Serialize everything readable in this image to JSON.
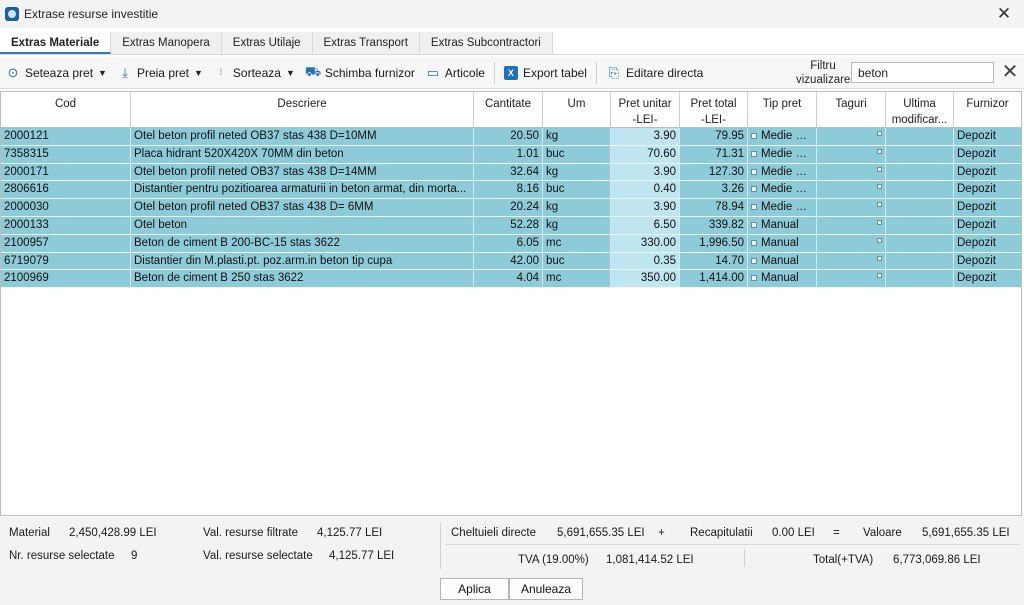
{
  "window": {
    "title": "Extrase resurse investitie"
  },
  "tabs": [
    {
      "label": "Extras Materiale"
    },
    {
      "label": "Extras Manopera"
    },
    {
      "label": "Extras Utilaje"
    },
    {
      "label": "Extras Transport"
    },
    {
      "label": "Extras Subcontractori"
    }
  ],
  "toolbar": {
    "seteaza_pret": "Seteaza pret",
    "preia_pret": "Preia pret",
    "sorteaza": "Sorteaza",
    "schimba_furnizor": "Schimba furnizor",
    "articole": "Articole",
    "export_tabel": "Export tabel",
    "editare_directa": "Editare directa",
    "filter_label_1": "Filtru",
    "filter_label_2": "vizualizare",
    "filter_value": "beton"
  },
  "grid": {
    "headers": {
      "cod": "Cod",
      "descriere": "Descriere",
      "cantitate": "Cantitate",
      "um": "Um",
      "pret_unitar_1": "Pret unitar",
      "pret_unitar_2": "-LEI-",
      "pret_total_1": "Pret total",
      "pret_total_2": "-LEI-",
      "tip_pret": "Tip pret",
      "taguri": "Taguri",
      "ultima_1": "Ultima",
      "ultima_2": "modificar...",
      "furnizor": "Furnizor"
    },
    "rows": [
      {
        "cod": "2000121",
        "descriere": "Otel beton profil neted OB37 stas 438 D=10MM",
        "cantitate": "20.50",
        "um": "kg",
        "pret_unitar": "3.90",
        "pret_total": "79.95",
        "tip_pret": "Medie pi...",
        "furnizor": "Depozit"
      },
      {
        "cod": "7358315",
        "descriere": "Placa hidrant 520X420X 70MM din beton",
        "cantitate": "1.01",
        "um": "buc",
        "pret_unitar": "70.60",
        "pret_total": "71.31",
        "tip_pret": "Medie pi...",
        "furnizor": "Depozit"
      },
      {
        "cod": "2000171",
        "descriere": "Otel beton profil neted OB37 stas 438 D=14MM",
        "cantitate": "32.64",
        "um": "kg",
        "pret_unitar": "3.90",
        "pret_total": "127.30",
        "tip_pret": "Medie pi...",
        "furnizor": "Depozit"
      },
      {
        "cod": "2806616",
        "descriere": "Distantier pentru pozitioarea armaturii in beton armat, din morta...",
        "cantitate": "8.16",
        "um": "buc",
        "pret_unitar": "0.40",
        "pret_total": "3.26",
        "tip_pret": "Medie pi...",
        "furnizor": "Depozit"
      },
      {
        "cod": "2000030",
        "descriere": "Otel beton profil neted OB37 stas 438 D= 6MM",
        "cantitate": "20.24",
        "um": "kg",
        "pret_unitar": "3.90",
        "pret_total": "78.94",
        "tip_pret": "Medie pi...",
        "furnizor": "Depozit"
      },
      {
        "cod": "2000133",
        "descriere": "Otel beton",
        "cantitate": "52.28",
        "um": "kg",
        "pret_unitar": "6.50",
        "pret_total": "339.82",
        "tip_pret": "Manual",
        "furnizor": "Depozit"
      },
      {
        "cod": "2100957",
        "descriere": "Beton de ciment B 200-BC-15 stas 3622",
        "cantitate": "6.05",
        "um": "mc",
        "pret_unitar": "330.00",
        "pret_total": "1,996.50",
        "tip_pret": "Manual",
        "furnizor": "Depozit"
      },
      {
        "cod": "6719079",
        "descriere": "Distantier din M.plasti.pt. poz.arm.in beton tip cupa",
        "cantitate": "42.00",
        "um": "buc",
        "pret_unitar": "0.35",
        "pret_total": "14.70",
        "tip_pret": "Manual",
        "furnizor": "Depozit"
      },
      {
        "cod": "2100969",
        "descriere": "Beton de ciment B 250 stas 3622",
        "cantitate": "4.04",
        "um": "mc",
        "pret_unitar": "350.00",
        "pret_total": "1,414.00",
        "tip_pret": "Manual",
        "furnizor": "Depozit"
      }
    ]
  },
  "footer": {
    "material_label": "Material",
    "material_value": "2,450,428.99 LEI",
    "nr_resurse_label": "Nr. resurse selectate",
    "nr_resurse_value": "9",
    "val_filtrate_label": "Val. resurse filtrate",
    "val_filtrate_value": "4,125.77 LEI",
    "val_selectate_label": "Val. resurse selectate",
    "val_selectate_value": "4,125.77 LEI",
    "cheltuieli_label": "Cheltuieli directe",
    "cheltuieli_value": "5,691,655.35 LEI",
    "plus": "+",
    "recap_label": "Recapitulatii",
    "recap_value": "0.00 LEI",
    "equals": "=",
    "valoare_label": "Valoare",
    "valoare_value": "5,691,655.35 LEI",
    "tva_label": "TVA (19.00%)",
    "tva_value": "1,081,414.52 LEI",
    "total_label": "Total(+TVA)",
    "total_value": "6,773,069.86 LEI",
    "aplica": "Aplica",
    "anuleaza": "Anuleaza"
  }
}
